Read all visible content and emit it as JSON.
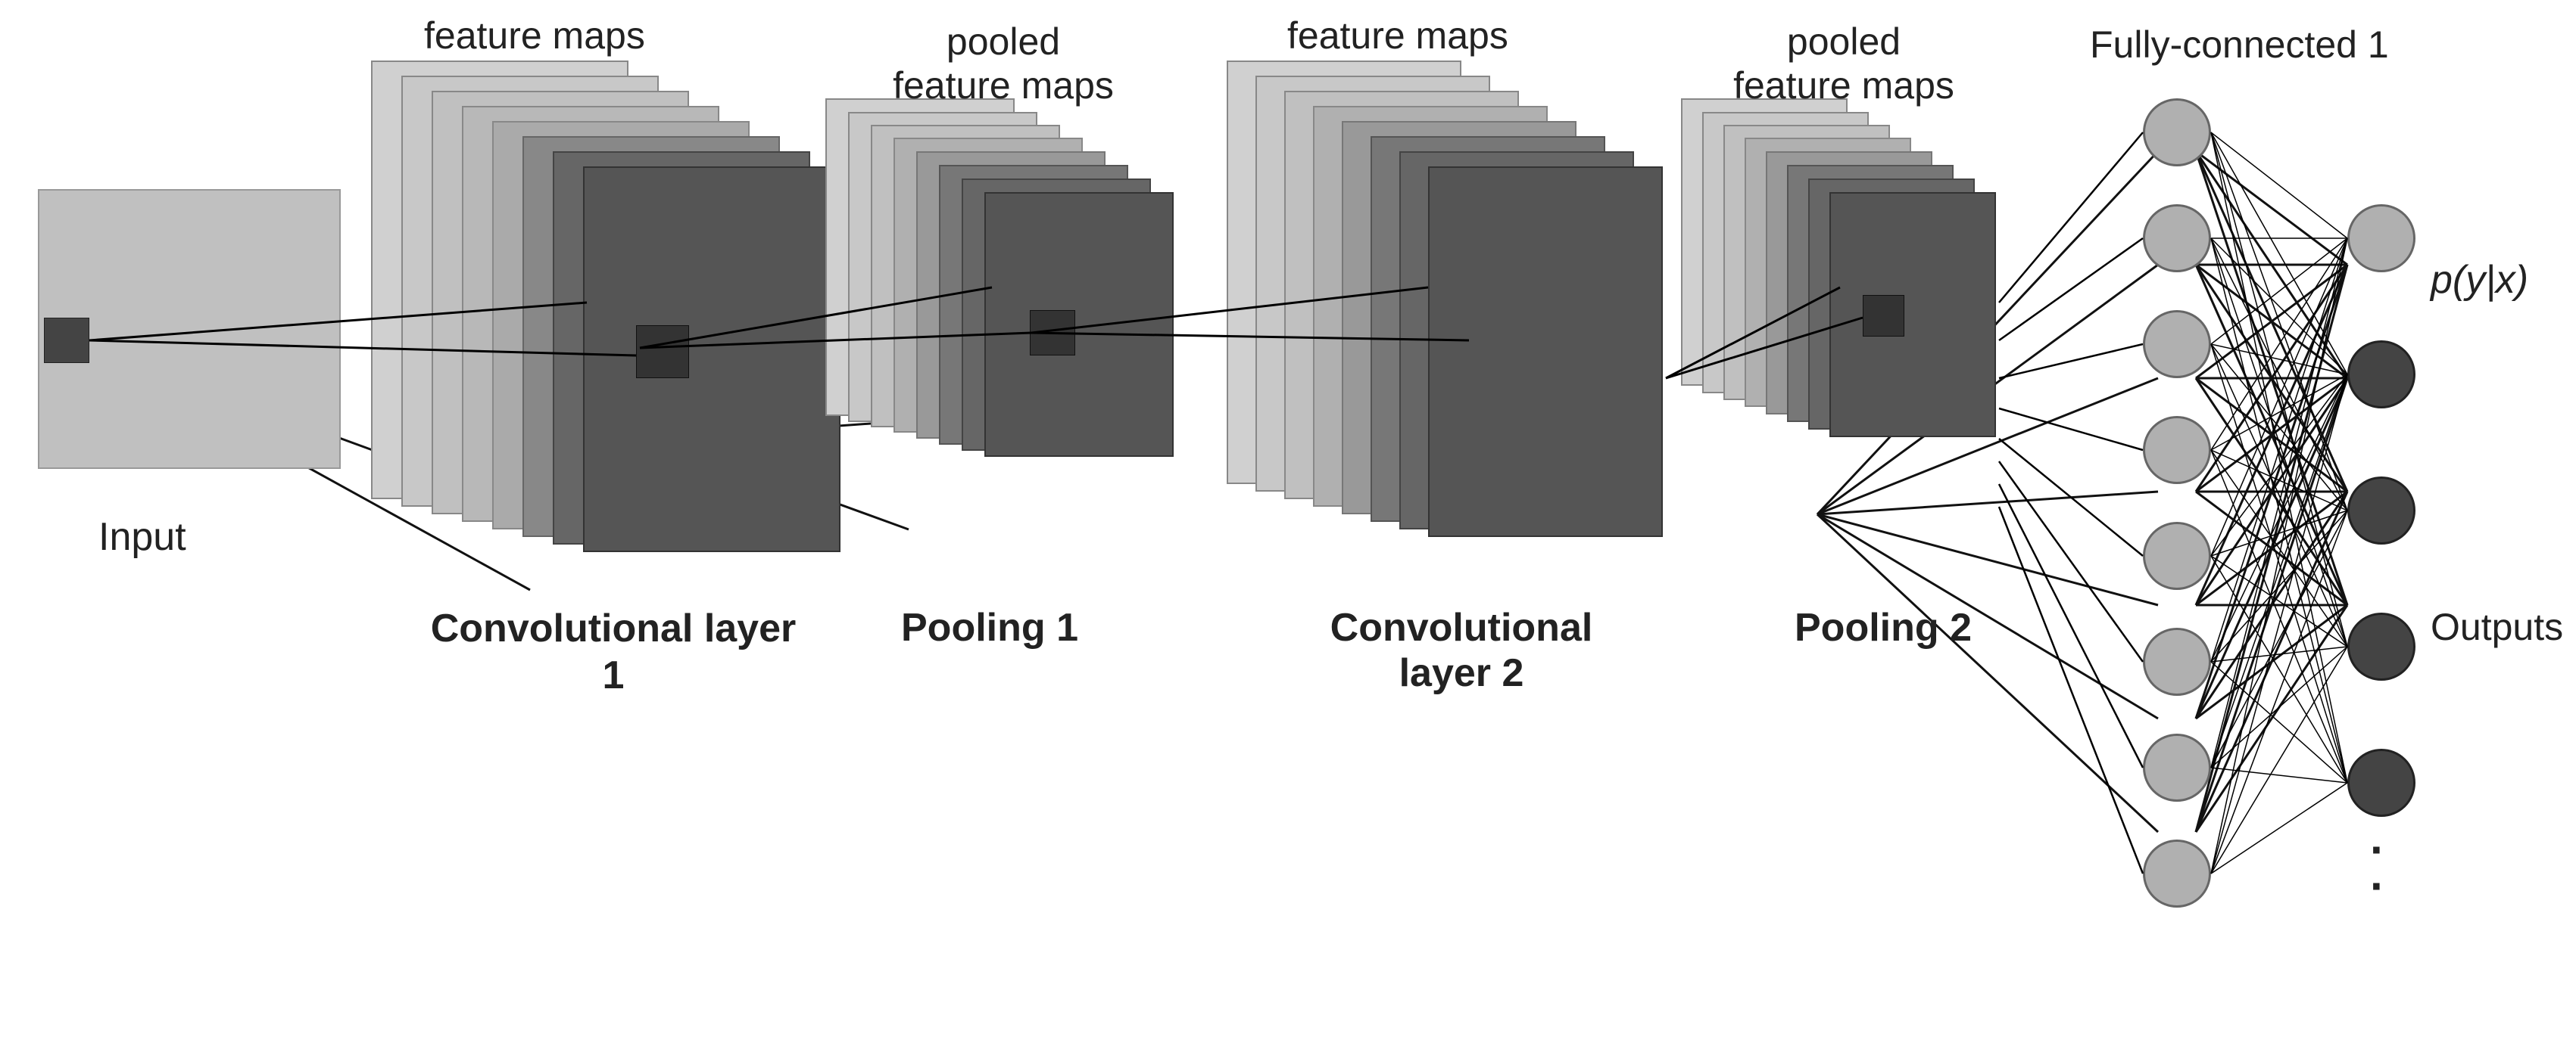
{
  "labels": {
    "input": "Input",
    "feature_maps_1": "feature maps",
    "pooled_feature_maps_1": "pooled\nfeature maps",
    "feature_maps_2": "feature maps",
    "pooled_feature_maps_2": "pooled\nfeature maps",
    "conv_layer_1": "Convolutional\nlayer 1",
    "pooling_1": "Pooling 1",
    "conv_layer_2": "Convolutional\nlayer 2",
    "pooling_2": "Pooling 2",
    "fully_connected": "Fully-connected 1",
    "outputs": "Outputs",
    "probability": "p(y|x)",
    "dots": "."
  },
  "colors": {
    "light_gray": "#c8c8c8",
    "mid_gray": "#999",
    "dark_gray": "#555",
    "darker_gray": "#444",
    "darkest": "#333",
    "input_bg": "#b8b8b8",
    "white": "#ffffff",
    "neuron_light": "#b0b0b0",
    "neuron_dark": "#444444"
  }
}
